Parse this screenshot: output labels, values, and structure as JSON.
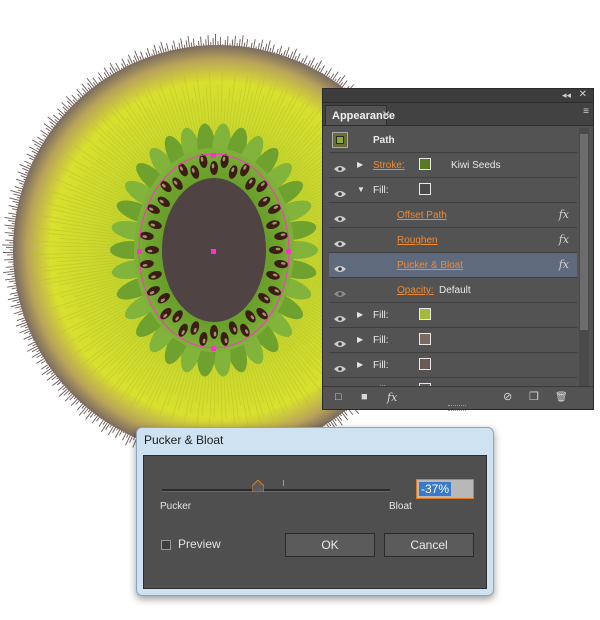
{
  "panel": {
    "tab_label": "Appearance",
    "collapse_glyph": "◂◂",
    "close_glyph": "✕",
    "tab_close_glyph": "✕",
    "menu_glyph": "≡",
    "rows": [
      {
        "kind": "header",
        "label": "Path"
      },
      {
        "kind": "stroke",
        "label": "Stroke:",
        "swatch": "#5a7a22",
        "value": "Kiwi Seeds"
      },
      {
        "kind": "fill",
        "label": "Fill:",
        "swatch": "#4a4a4a"
      },
      {
        "kind": "effect",
        "label": "Offset Path"
      },
      {
        "kind": "effect",
        "label": "Roughen"
      },
      {
        "kind": "effect-sel",
        "label": "Pucker & Bloat"
      },
      {
        "kind": "opacity",
        "label": "Opacity:",
        "value": "Default"
      },
      {
        "kind": "fill",
        "label": "Fill:",
        "swatch": "#a4b83a"
      },
      {
        "kind": "fill",
        "label": "Fill:",
        "swatch": "#7a6a62"
      },
      {
        "kind": "fill",
        "label": "Fill:",
        "swatch": "#6a5a55"
      },
      {
        "kind": "fill",
        "label": "Fill:",
        "swatch": "#5a5a5a"
      }
    ],
    "fx_glyph": "fx",
    "footer": {
      "new_stroke_icon": "□",
      "new_fill_icon": "■",
      "fx_label": "fx",
      "clear_icon": "⊘",
      "duplicate_icon": "❐",
      "delete_icon": "🗑"
    }
  },
  "dialog": {
    "title": "Pucker & Bloat",
    "left_label": "Pucker",
    "right_label": "Bloat",
    "value": "-37%",
    "slider_fraction": 0.42,
    "preview_label": "Preview",
    "ok_label": "OK",
    "cancel_label": "Cancel"
  },
  "colors": {
    "kiwi_flesh": "#c9d62a",
    "kiwi_fur": "#6a5a55",
    "seed_ring": "#6b9a2b",
    "core": "#4f4343",
    "selection": "#ff33cc"
  }
}
